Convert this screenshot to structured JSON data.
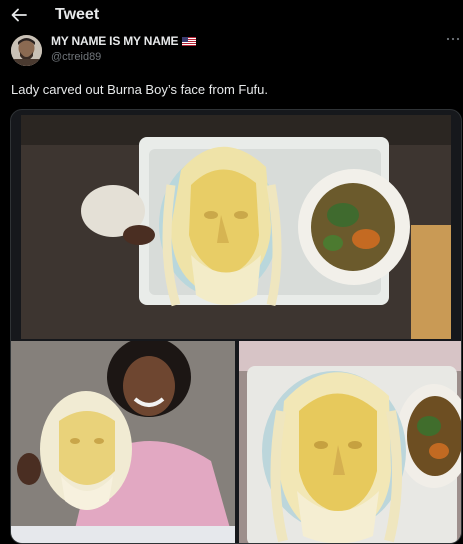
{
  "header": {
    "title": "Tweet",
    "back_icon": "arrow-left-icon"
  },
  "author": {
    "display_name": "MY NAME IS MY NAME",
    "flag": "us-flag-icon",
    "handle": "@ctreid89"
  },
  "tweet": {
    "text": "Lady carved out Burna Boy’s face from Fufu."
  },
  "media": {
    "photos": [
      "photo-fufu-face-tray",
      "photo-woman-holding-fufu-face",
      "photo-fufu-face-with-sauce"
    ]
  },
  "colors": {
    "background": "#000000",
    "text": "#e7e9ea",
    "secondary": "#71767b",
    "border": "#2f3336"
  }
}
